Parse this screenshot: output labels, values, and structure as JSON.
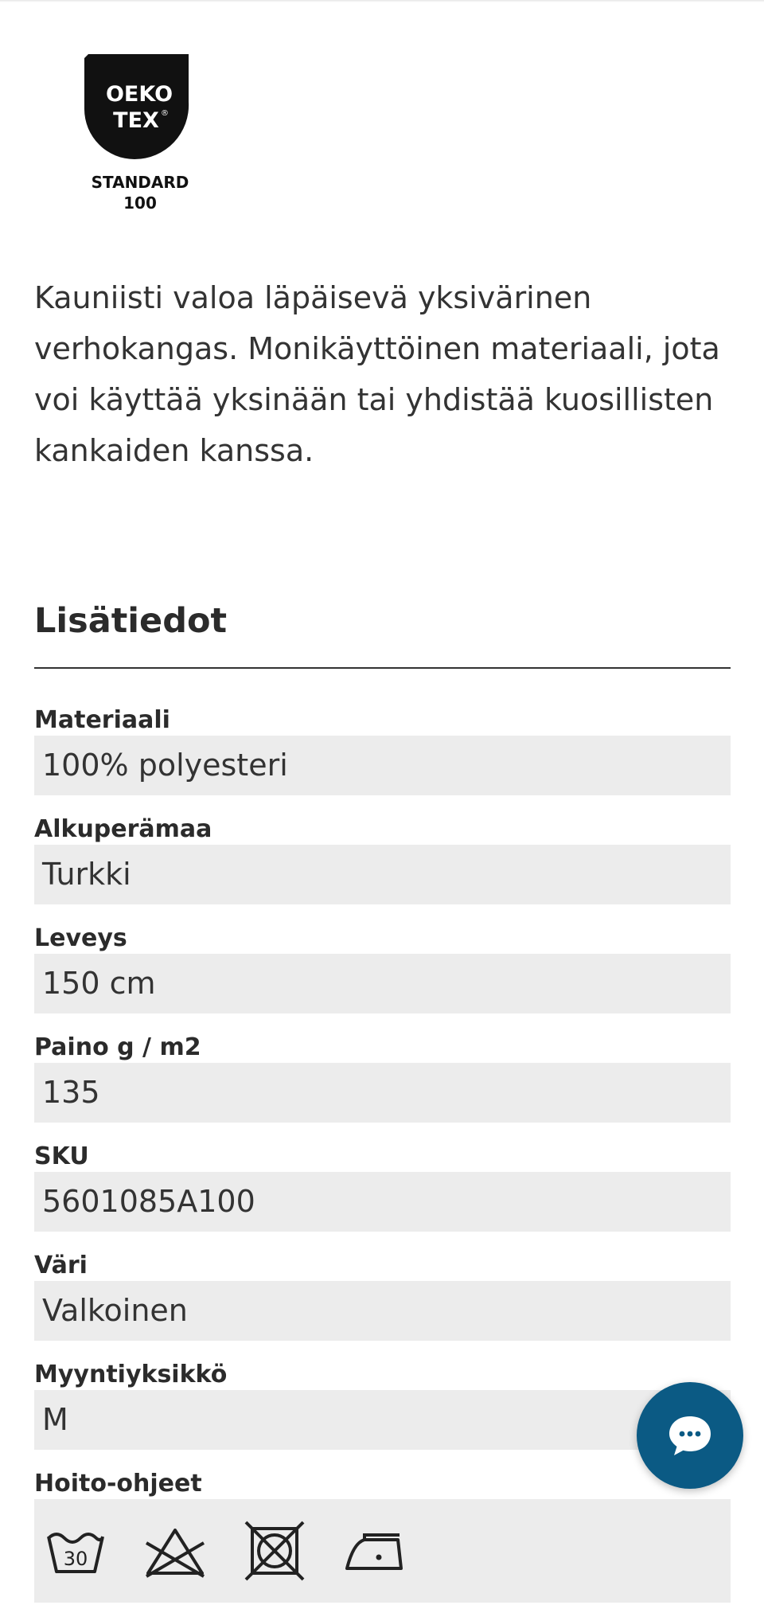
{
  "logo": {
    "mark_line1": "OEKO",
    "mark_line2": "TEX",
    "caption_line1": "STANDARD",
    "caption_line2": "100"
  },
  "description": "Kauniisti valoa läpäisevä yksivärinen verhokangas. Monikäyttöinen materiaali, jota voi käyttää yksinään tai yhdistää kuosillisten kankaiden kanssa.",
  "details": {
    "title": "Lisätiedot",
    "attributes": [
      {
        "label": "Materiaali",
        "value": "100% polyesteri"
      },
      {
        "label": "Alkuperämaa",
        "value": "Turkki"
      },
      {
        "label": "Leveys",
        "value": "150 cm"
      },
      {
        "label": "Paino g / m2",
        "value": "135"
      },
      {
        "label": "SKU",
        "value": "5601085A100"
      },
      {
        "label": "Väri",
        "value": "Valkoinen"
      },
      {
        "label": "Myyntiyksikkö",
        "value": "M"
      }
    ],
    "care_label": "Hoito-ohjeet",
    "care_icons": [
      {
        "icon": "wash-30-icon",
        "temperature": "30"
      },
      {
        "icon": "no-bleach-icon"
      },
      {
        "icon": "no-tumble-dry-icon"
      },
      {
        "icon": "iron-low-icon"
      }
    ]
  },
  "chat": {
    "icon": "chat-bubble-icon",
    "color": "#0b5a84"
  }
}
